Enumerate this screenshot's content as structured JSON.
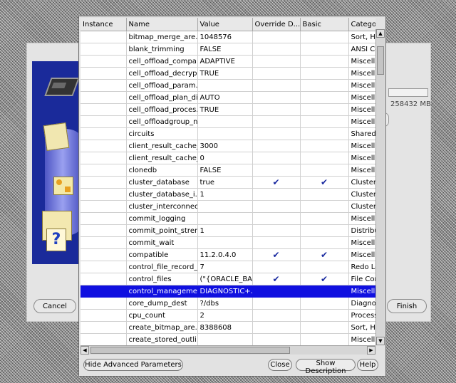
{
  "background_dialog": {
    "size_label": "258432 MB",
    "cancel_label": "Cancel",
    "finish_label": "Finish"
  },
  "table": {
    "columns": [
      "Instance",
      "Name",
      "Value",
      "Override D...",
      "Basic",
      "Categor"
    ],
    "check_mark": "✔",
    "rows": [
      {
        "instance": "",
        "name": "bitmap_merge_are...",
        "value": "1048576",
        "override": false,
        "basic": false,
        "category": "Sort, Ha"
      },
      {
        "instance": "",
        "name": "blank_trimming",
        "value": "FALSE",
        "override": false,
        "basic": false,
        "category": "ANSI Co"
      },
      {
        "instance": "",
        "name": "cell_offload_compa...",
        "value": "ADAPTIVE",
        "override": false,
        "basic": false,
        "category": "Miscella"
      },
      {
        "instance": "",
        "name": "cell_offload_decryp...",
        "value": "TRUE",
        "override": false,
        "basic": false,
        "category": "Miscella"
      },
      {
        "instance": "",
        "name": "cell_offload_param...",
        "value": "",
        "override": false,
        "basic": false,
        "category": "Miscella"
      },
      {
        "instance": "",
        "name": "cell_offload_plan_di...",
        "value": "AUTO",
        "override": false,
        "basic": false,
        "category": "Miscella"
      },
      {
        "instance": "",
        "name": "cell_offload_proces...",
        "value": "TRUE",
        "override": false,
        "basic": false,
        "category": "Miscella"
      },
      {
        "instance": "",
        "name": "cell_offloadgroup_n...",
        "value": "",
        "override": false,
        "basic": false,
        "category": "Miscella"
      },
      {
        "instance": "",
        "name": "circuits",
        "value": "",
        "override": false,
        "basic": false,
        "category": "Shared"
      },
      {
        "instance": "",
        "name": "client_result_cache_...",
        "value": "3000",
        "override": false,
        "basic": false,
        "category": "Miscella"
      },
      {
        "instance": "",
        "name": "client_result_cache_...",
        "value": "0",
        "override": false,
        "basic": false,
        "category": "Miscella"
      },
      {
        "instance": "",
        "name": "clonedb",
        "value": "FALSE",
        "override": false,
        "basic": false,
        "category": "Miscella"
      },
      {
        "instance": "",
        "name": "cluster_database",
        "value": "true",
        "override": true,
        "basic": true,
        "category": "Cluster"
      },
      {
        "instance": "",
        "name": "cluster_database_i...",
        "value": "1",
        "override": false,
        "basic": false,
        "category": "Cluster"
      },
      {
        "instance": "",
        "name": "cluster_interconnects",
        "value": "",
        "override": false,
        "basic": false,
        "category": "Cluster"
      },
      {
        "instance": "",
        "name": "commit_logging",
        "value": "",
        "override": false,
        "basic": false,
        "category": "Miscella"
      },
      {
        "instance": "",
        "name": "commit_point_stren...",
        "value": "1",
        "override": false,
        "basic": false,
        "category": "Distribu"
      },
      {
        "instance": "",
        "name": "commit_wait",
        "value": "",
        "override": false,
        "basic": false,
        "category": "Miscella"
      },
      {
        "instance": "",
        "name": "compatible",
        "value": "11.2.0.4.0",
        "override": true,
        "basic": true,
        "category": "Miscella"
      },
      {
        "instance": "",
        "name": "control_file_record_...",
        "value": "7",
        "override": false,
        "basic": false,
        "category": "Redo Lo"
      },
      {
        "instance": "",
        "name": "control_files",
        "value": "(\"{ORACLE_BA...",
        "override": true,
        "basic": true,
        "category": "File Con"
      },
      {
        "instance": "",
        "name": "control_manageme...",
        "value": "DIAGNOSTIC+...",
        "override": false,
        "basic": false,
        "category": "Miscella",
        "selected": true
      },
      {
        "instance": "",
        "name": "core_dump_dest",
        "value": "?/dbs",
        "override": false,
        "basic": false,
        "category": "Diagnos"
      },
      {
        "instance": "",
        "name": "cpu_count",
        "value": "2",
        "override": false,
        "basic": false,
        "category": "Process"
      },
      {
        "instance": "",
        "name": "create_bitmap_are...",
        "value": "8388608",
        "override": false,
        "basic": false,
        "category": "Sort, Ha"
      },
      {
        "instance": "",
        "name": "create_stored_outli...",
        "value": "",
        "override": false,
        "basic": false,
        "category": "Miscella"
      }
    ]
  },
  "buttons": {
    "hide_advanced": "Hide Advanced Parameters",
    "close": "Close",
    "show_description": "Show Description",
    "help": "Help"
  },
  "scrollbars": {
    "up": "▲",
    "down": "▼",
    "left": "◀",
    "right": "▶"
  },
  "icons": [
    "chip-icon",
    "database-disk-icon",
    "documents-icon",
    "shapes-icon",
    "folders-icon",
    "help-icon"
  ]
}
